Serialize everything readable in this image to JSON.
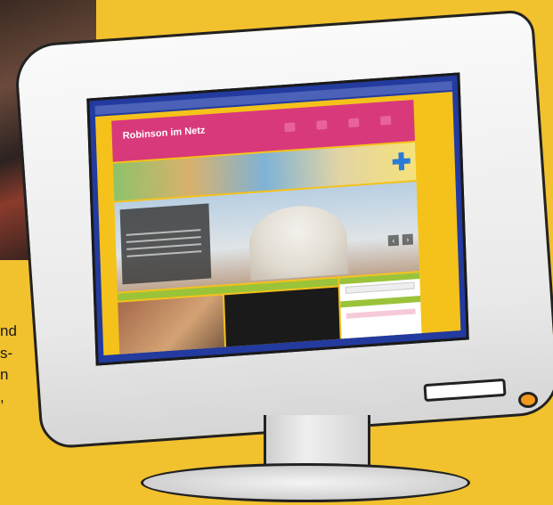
{
  "side_text": {
    "lines": [
      "nd",
      "s-",
      "n",
      ","
    ]
  },
  "website": {
    "title": "Robinson im Netz",
    "subtitle": "",
    "nav": [
      "",
      "",
      "",
      ""
    ],
    "caption_title": "",
    "colors": {
      "page_bg": "#f2c12e",
      "screen_frame": "#233a9e",
      "header": "#d8397a",
      "accent_green": "#9bc33a",
      "plus": "#2a7bd6",
      "power_led": "#f39a1e"
    }
  },
  "icons": {
    "plus": "plus-icon",
    "prev": "chevron-left-icon",
    "next": "chevron-right-icon"
  }
}
